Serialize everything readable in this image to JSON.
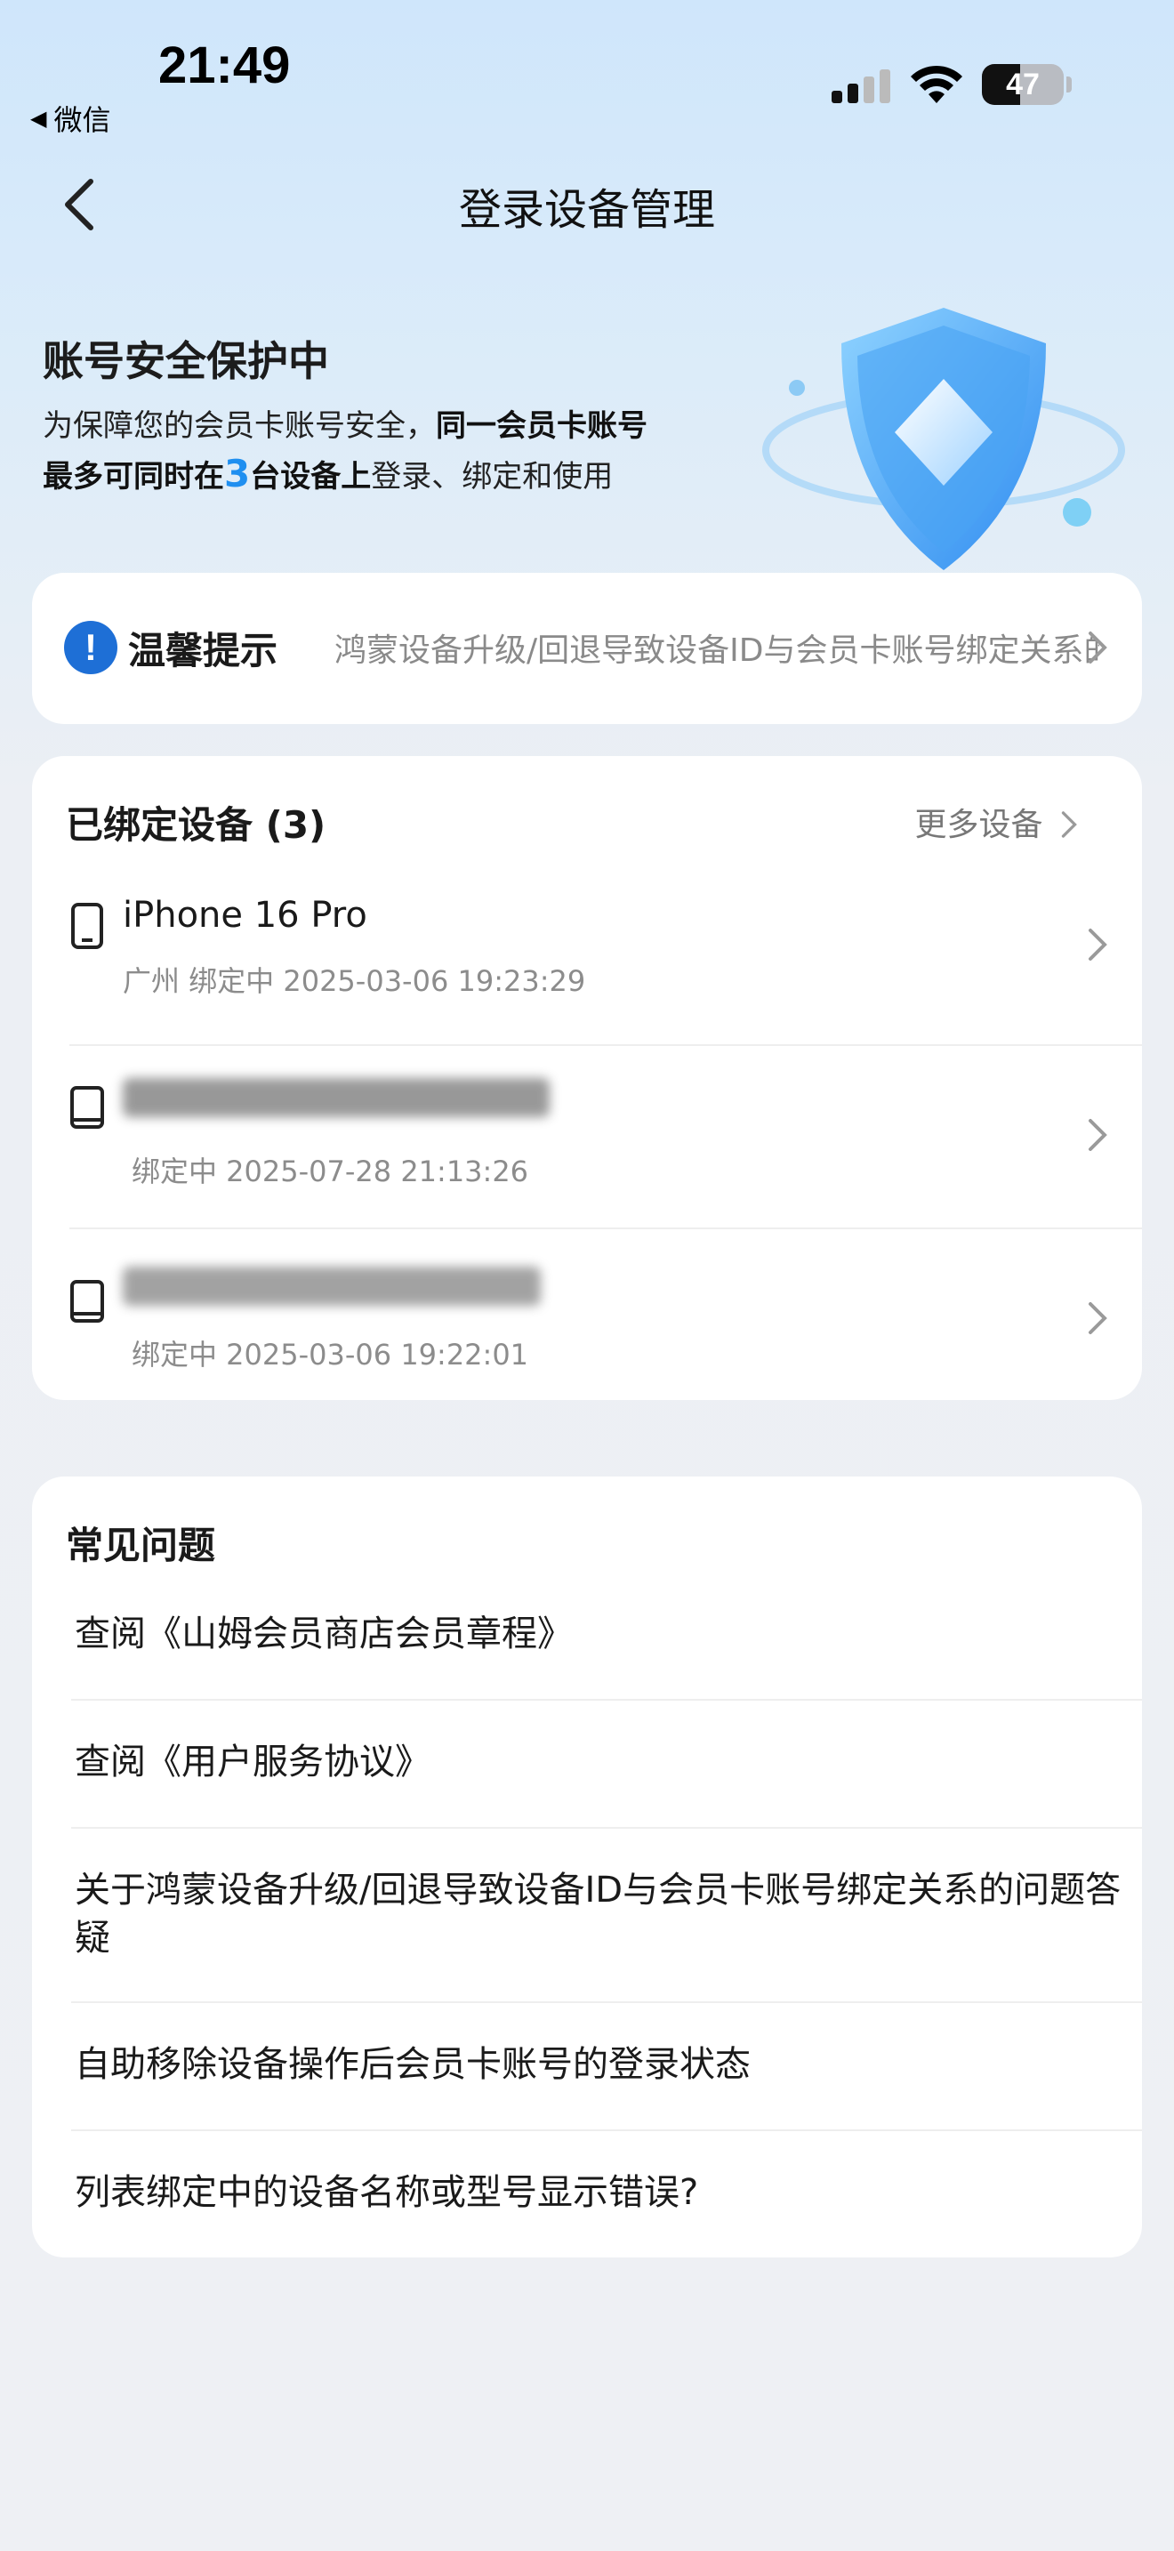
{
  "status": {
    "time": "21:49",
    "back_app": "微信",
    "battery": "47",
    "battery_level": 0.47
  },
  "nav": {
    "title": "登录设备管理"
  },
  "hero": {
    "title": "账号安全保护中",
    "desc_part1": "为保障您的会员卡账号安全，",
    "desc_bold1": "同一会员卡账号",
    "desc_bold2": "最多可同时在",
    "desc_num": "3",
    "desc_bold3": "台设备上",
    "desc_part2": "登录、绑定和使用"
  },
  "tip": {
    "label": "温馨提示",
    "text": "鸿蒙设备升级/回退导致设备ID与会员卡账号绑定关系的问题答疑"
  },
  "devices": {
    "header": "已绑定设备 (3)",
    "more": "更多设备",
    "items": [
      {
        "name": "iPhone 16 Pro",
        "meta": "广州 绑定中 2025-03-06 19:23:29",
        "icon": "phone-icon"
      },
      {
        "name": "",
        "meta": "绑定中 2025-07-28 21:13:26",
        "icon": "tablet-icon"
      },
      {
        "name": "",
        "meta": "绑定中 2025-03-06 19:22:01",
        "icon": "tablet-icon"
      }
    ]
  },
  "faq": {
    "header": "常见问题",
    "items": [
      "查阅《山姆会员商店会员章程》",
      "查阅《用户服务协议》",
      "关于鸿蒙设备升级/回退导致设备ID与会员卡账号绑定关系的问题答疑",
      "自助移除设备操作后会员卡账号的登录状态",
      "列表绑定中的设备名称或型号显示错误?"
    ]
  },
  "colors": {
    "accent": "#1f8ff0",
    "tip_icon": "#1e6fd6"
  }
}
